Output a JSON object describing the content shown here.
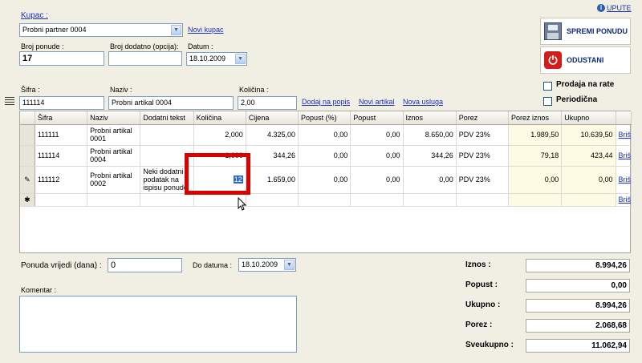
{
  "header": {
    "kupac_label": "Kupac :",
    "kupac_value": "Probni partner 0004",
    "novi_kupac": "Novi kupac",
    "upute": "UPUTE",
    "broj_ponude_label": "Broj ponude :",
    "broj_ponude_value": "17",
    "broj_dodatno_label": "Broj dodatno (opcija):",
    "broj_dodatno_value": "",
    "datum_label": "Datum :",
    "datum_value": "18.10.2009"
  },
  "actions": {
    "spremi": "SPREMI PONUDU",
    "odustani": "ODUSTANI"
  },
  "options": {
    "prodaja_na_rate": "Prodaja na rate",
    "periodicna": "Periodična"
  },
  "entry": {
    "sifra_label": "Šifra :",
    "sifra_value": "111114",
    "naziv_label": "Naziv :",
    "naziv_value": "Probni artikal 0004",
    "kolicina_label": "Količina :",
    "kolicina_value": "2,00",
    "dodaj_na_popis": "Dodaj na popis",
    "novi_artikal": "Novi artikal",
    "nova_usluga": "Nova usluga"
  },
  "grid": {
    "columns": [
      "Šifra",
      "Naziv",
      "Dodatni tekst",
      "Količina",
      "Cijena",
      "Popust (%)",
      "Popust",
      "Iznos",
      "Porez",
      "Porez iznos",
      "Ukupno",
      ""
    ],
    "rows": [
      {
        "sifra": "111111",
        "naziv": "Probni artikal 0001",
        "dodatni": "",
        "kolicina": "2,000",
        "cijena": "4.325,00",
        "popust_pct": "0,00",
        "popust": "0,00",
        "iznos": "8.650,00",
        "porez": "PDV 23%",
        "porez_iznos": "1.989,50",
        "ukupno": "10.639,50",
        "action": "Briši"
      },
      {
        "sifra": "111114",
        "naziv": "Probni artikal 0004",
        "dodatni": "",
        "kolicina": "1,000",
        "cijena": "344,26",
        "popust_pct": "0,00",
        "popust": "0,00",
        "iznos": "344,26",
        "porez": "PDV 23%",
        "porez_iznos": "79,18",
        "ukupno": "423,44",
        "action": "Briši"
      },
      {
        "sifra": "111112",
        "naziv": "Probni artikal 0002",
        "dodatni": "Neki dodatni podatak na ispisu ponude",
        "kolicina": "12",
        "cijena": "1.659,00",
        "popust_pct": "0,00",
        "popust": "0,00",
        "iznos": "0,00",
        "porez": "PDV 23%",
        "porez_iznos": "0,00",
        "ukupno": "0,00",
        "action": "Briši"
      }
    ],
    "new_row_action": "Briši"
  },
  "footer": {
    "ponuda_vrijedi_label": "Ponuda vrijedi (dana) :",
    "ponuda_vrijedi_value": "0",
    "do_datuma_label": "Do datuma :",
    "do_datuma_value": "18.10.2009",
    "komentar_label": "Komentar :",
    "komentar_value": ""
  },
  "totals": {
    "iznos_label": "Iznos :",
    "iznos_value": "8.994,26",
    "popust_label": "Popust :",
    "popust_value": "0,00",
    "ukupno_label": "Ukupno :",
    "ukupno_value": "8.994,26",
    "porez_label": "Porez :",
    "porez_value": "2.068,68",
    "sveukupno_label": "Sveukupno :",
    "sveukupno_value": "11.062,94"
  },
  "colors": {
    "background": "#f1efe3",
    "link": "#1a2fbf",
    "highlight_box": "#d90000",
    "selection": "#316ac5"
  }
}
